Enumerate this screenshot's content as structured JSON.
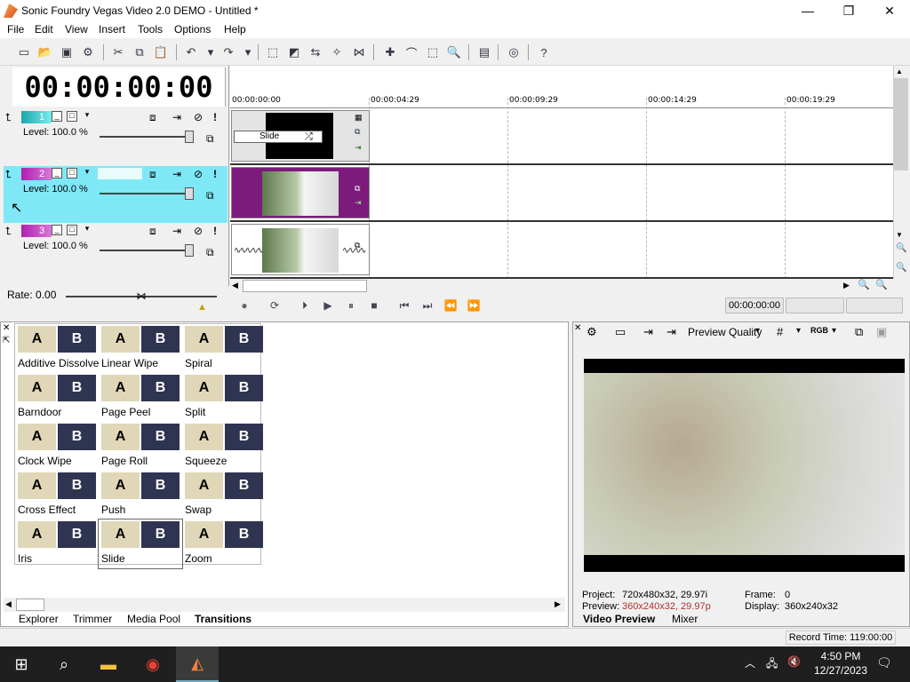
{
  "app": {
    "title": "Sonic Foundry Vegas Video 2.0 DEMO - Untitled *"
  },
  "window": {
    "minimize": "—",
    "maximize": "❐",
    "close": "✕"
  },
  "menu": [
    "File",
    "Edit",
    "View",
    "Insert",
    "Tools",
    "Options",
    "Help"
  ],
  "timecode": "00:00:00:00",
  "ruler": [
    "00:00:00:00",
    "00:00:04:29",
    "00:00:09:29",
    "00:00:14:29",
    "00:00:19:29"
  ],
  "tracks": [
    {
      "num": "1",
      "color": "#1ba7a7",
      "level": "Level: 100.0 %"
    },
    {
      "num": "2",
      "color": "#b11fb1",
      "level": "Level: 100.0 %"
    },
    {
      "num": "3",
      "color": "#b11fb1",
      "level": "Level: 100.0 %"
    }
  ],
  "clip1_label": "Slide",
  "rate": "Rate: 0.00",
  "transport_time": "00:00:00:00",
  "transitions": [
    {
      "label": "Additive Dissolve"
    },
    {
      "label": "Linear Wipe"
    },
    {
      "label": "Spiral"
    },
    {
      "label": "Barndoor"
    },
    {
      "label": "Page Peel"
    },
    {
      "label": "Split"
    },
    {
      "label": "Clock Wipe"
    },
    {
      "label": "Page Roll"
    },
    {
      "label": "Squeeze"
    },
    {
      "label": "Cross Effect"
    },
    {
      "label": "Push"
    },
    {
      "label": "Swap"
    },
    {
      "label": "Iris"
    },
    {
      "label": "Slide"
    },
    {
      "label": "Zoom"
    }
  ],
  "thumb_a": "A",
  "thumb_b": "B",
  "left_tabs": [
    "Explorer",
    "Trimmer",
    "Media Pool",
    "Transitions"
  ],
  "right_tabs": [
    "Video Preview",
    "Mixer"
  ],
  "preview_quality": "Preview Quality",
  "preview_info": {
    "project_label": "Project:",
    "project_value": "720x480x32, 29.97i",
    "preview_label": "Preview:",
    "preview_value": "360x240x32, 29.97p",
    "frame_label": "Frame:",
    "frame_value": "0",
    "display_label": "Display:",
    "display_value": "360x240x32"
  },
  "status": {
    "record_time": "Record Time: 119:00:00"
  },
  "taskbar": {
    "time": "4:50 PM",
    "date": "12/27/2023"
  }
}
